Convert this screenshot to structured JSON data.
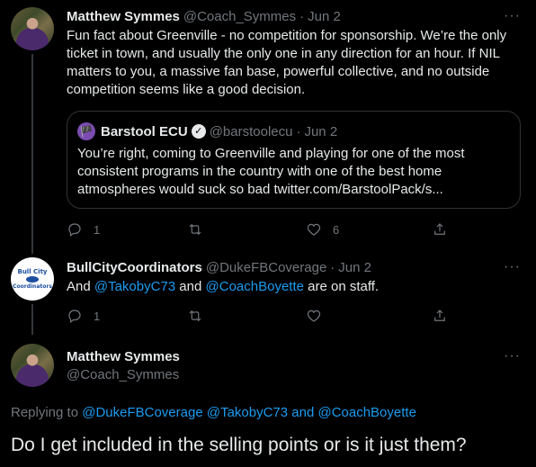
{
  "tweet1": {
    "name": "Matthew Symmes",
    "handle": "@Coach_Symmes",
    "sep": "·",
    "date": "Jun 2",
    "more": "···",
    "text": "Fun fact about Greenville - no competition for sponsorship. We’re the only ticket in town, and usually the only one in any direction for an hour. If NIL matters to you, a massive fan base, powerful collective, and no outside competition seems like a good decision.",
    "quote": {
      "avatar_glyph": "🏴",
      "name": "Barstool ECU",
      "verified_glyph": "✓",
      "handle": "@barstoolecu",
      "sep": "·",
      "date": "Jun 2",
      "text": "You’re right, coming to Greenville and playing for one of the most consistent programs in the country with one of the best home atmospheres would suck so bad twitter.com/BarstoolPack/s..."
    },
    "replies": "1",
    "retweets": "",
    "likes": "6"
  },
  "tweet2": {
    "name": "BullCityCoordinators",
    "handle": "@DukeFBCoverage",
    "sep": "·",
    "date": "Jun 2",
    "more": "···",
    "avatar_line1": "Bull City",
    "avatar_line2": "Coordinators",
    "text_prefix": "And ",
    "mention1": "@TakobyC73",
    "text_mid": " and ",
    "mention2": "@CoachBoyette",
    "text_suffix": " are on staff.",
    "replies": "1",
    "retweets": "",
    "likes": ""
  },
  "main_tweet": {
    "name": "Matthew Symmes",
    "handle": "@Coach_Symmes",
    "more": "···",
    "replying_prefix": "Replying to ",
    "replying_users": "@DukeFBCoverage @TakobyC73 and @CoachBoyette",
    "text": "Do I get included in the selling points or is it just them?"
  },
  "icons": [
    "reply-icon",
    "retweet-icon",
    "like-icon",
    "share-icon",
    "more-icon",
    "verified-icon"
  ]
}
